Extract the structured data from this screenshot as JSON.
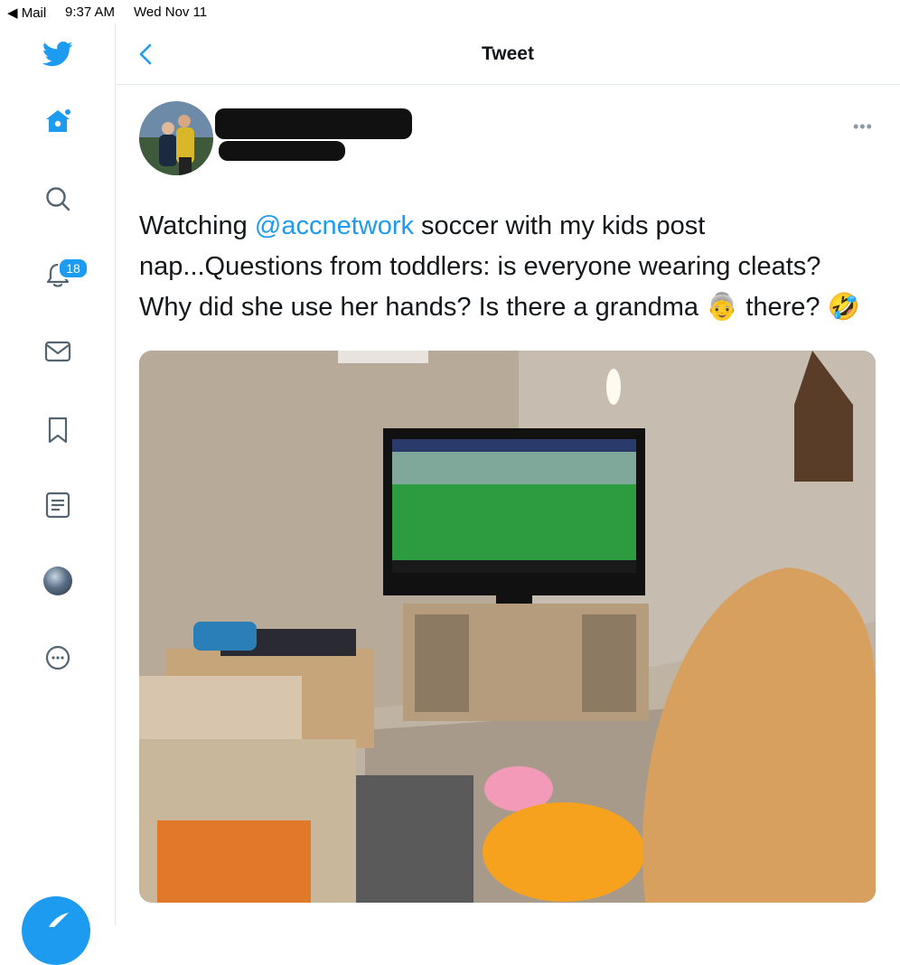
{
  "status_bar": {
    "back_app": "◀ Mail",
    "time": "9:37 AM",
    "date": "Wed Nov 11"
  },
  "sidebar": {
    "notifications_badge": "18",
    "items": [
      {
        "name": "home",
        "icon": "home-icon"
      },
      {
        "name": "explore",
        "icon": "search-icon"
      },
      {
        "name": "notifications",
        "icon": "bell-icon"
      },
      {
        "name": "messages",
        "icon": "envelope-icon"
      },
      {
        "name": "bookmarks",
        "icon": "bookmark-icon"
      },
      {
        "name": "lists",
        "icon": "list-icon"
      },
      {
        "name": "profile",
        "icon": "avatar"
      },
      {
        "name": "more",
        "icon": "more-circle-icon"
      }
    ]
  },
  "header": {
    "title": "Tweet"
  },
  "tweet": {
    "more_label": "•••",
    "text_part1": "Watching ",
    "mention": "@accnetwork",
    "text_part2": " soccer with my kids post nap...Questions from toddlers: is everyone wearing cleats? Why did she use her hands? Is there a grandma ",
    "emoji_grandma": "👵",
    "text_part3": " there? ",
    "emoji_laugh": "🤣"
  },
  "colors": {
    "accent": "#1d9bf0",
    "text": "#14171a",
    "divider": "#e1e8ed"
  }
}
